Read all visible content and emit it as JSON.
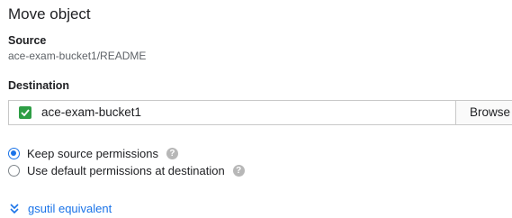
{
  "dialog": {
    "title": "Move object",
    "source_label": "Source",
    "source_value": "ace-exam-bucket1/README",
    "destination_label": "Destination",
    "destination_value": "ace-exam-bucket1",
    "browse_label": "Browse",
    "destination_icon": "bucket-icon"
  },
  "permissions": {
    "options": [
      {
        "label": "Keep source permissions",
        "selected": true
      },
      {
        "label": "Use default permissions at destination",
        "selected": false
      }
    ],
    "help_icon": "help-icon"
  },
  "gsutil": {
    "label": "gsutil equivalent",
    "icon": "double-chevron-down-icon"
  },
  "colors": {
    "accent": "#1a73e8",
    "bucket_icon": "#2e9e45",
    "help_icon": "#b7b7b7"
  }
}
